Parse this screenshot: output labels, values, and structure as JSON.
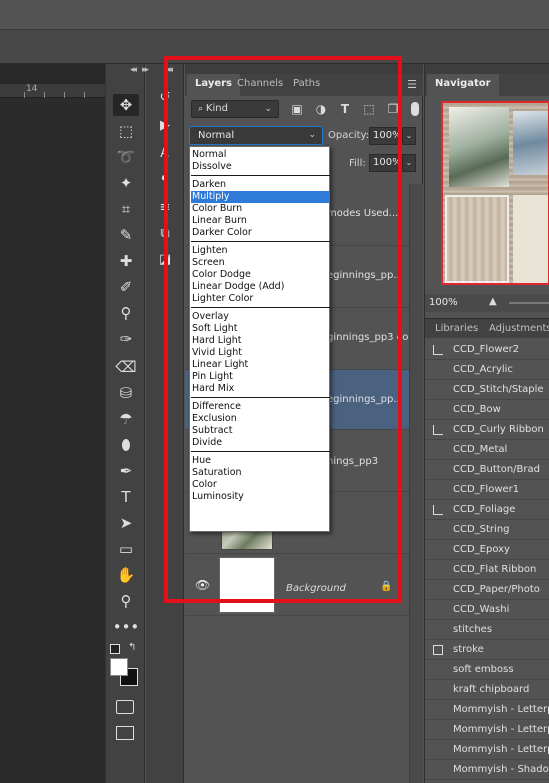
{
  "ruler": {
    "number": "14"
  },
  "tools": [
    {
      "name": "move-tool",
      "glyph": "✥"
    },
    {
      "name": "marquee-tool",
      "glyph": "⬚"
    },
    {
      "name": "lasso-tool",
      "glyph": "➰"
    },
    {
      "name": "magic-wand-tool",
      "glyph": "✦"
    },
    {
      "name": "crop-tool",
      "glyph": "⌗"
    },
    {
      "name": "eyedropper-tool",
      "glyph": "✎"
    },
    {
      "name": "healing-tool",
      "glyph": "✚"
    },
    {
      "name": "brush-tool",
      "glyph": "✐"
    },
    {
      "name": "stamp-tool",
      "glyph": "⚲"
    },
    {
      "name": "history-brush-tool",
      "glyph": "✑"
    },
    {
      "name": "eraser-tool",
      "glyph": "⌫"
    },
    {
      "name": "paint-bucket-tool",
      "glyph": "⛁"
    },
    {
      "name": "blur-tool",
      "glyph": "☂"
    },
    {
      "name": "dodge-tool",
      "glyph": "⬮"
    },
    {
      "name": "pen-tool",
      "glyph": "✒"
    },
    {
      "name": "type-tool",
      "glyph": "T"
    },
    {
      "name": "path-selection-tool",
      "glyph": "➤"
    },
    {
      "name": "shape-tool",
      "glyph": "▭"
    },
    {
      "name": "hand-tool",
      "glyph": "✋"
    },
    {
      "name": "zoom-tool",
      "glyph": "⚲"
    },
    {
      "name": "more-tools",
      "glyph": "•••"
    }
  ],
  "layers_panel": {
    "tabs": [
      "Layers",
      "Channels",
      "Paths"
    ],
    "kind_label": "Kind",
    "blend_mode": "Normal",
    "opacity_label": "Opacity:",
    "opacity_value": "100%",
    "fill_label": "Fill:",
    "fill_value": "100%",
    "layers": [
      {
        "name": "modes Used..."
      },
      {
        "name": "eginnings_pp..."
      },
      {
        "name": "ginnings_pp3 co..."
      },
      {
        "name": "eginnings_pp..."
      },
      {
        "name": "nings_pp3"
      },
      {
        "name": ""
      },
      {
        "name": "Background"
      }
    ]
  },
  "blend_modes": [
    [
      "Normal",
      "Dissolve"
    ],
    [
      "Darken",
      "Multiply",
      "Color Burn",
      "Linear Burn",
      "Darker Color"
    ],
    [
      "Lighten",
      "Screen",
      "Color Dodge",
      "Linear Dodge (Add)",
      "Lighter Color"
    ],
    [
      "Overlay",
      "Soft Light",
      "Hard Light",
      "Vivid Light",
      "Linear Light",
      "Pin Light",
      "Hard Mix"
    ],
    [
      "Difference",
      "Exclusion",
      "Subtract",
      "Divide"
    ],
    [
      "Hue",
      "Saturation",
      "Color",
      "Luminosity"
    ]
  ],
  "highlighted_blend_mode": "Multiply",
  "navigator": {
    "tab": "Navigator",
    "zoom": "100%"
  },
  "side_tabs": [
    "Libraries",
    "Adjustments"
  ],
  "actions": [
    {
      "label": "CCD_Flower2",
      "check": "mark"
    },
    {
      "label": "CCD_Acrylic",
      "check": "none"
    },
    {
      "label": "CCD_Stitch/Staple",
      "check": "none"
    },
    {
      "label": "CCD_Bow",
      "check": "none"
    },
    {
      "label": "CCD_Curly Ribbon",
      "check": "mark"
    },
    {
      "label": "CCD_Metal",
      "check": "none"
    },
    {
      "label": "CCD_Button/Brad",
      "check": "none"
    },
    {
      "label": "CCD_Flower1",
      "check": "none"
    },
    {
      "label": "CCD_Foliage",
      "check": "mark"
    },
    {
      "label": "CCD_String",
      "check": "none"
    },
    {
      "label": "CCD_Epoxy",
      "check": "none"
    },
    {
      "label": "CCD_Flat Ribbon",
      "check": "none"
    },
    {
      "label": "CCD_Paper/Photo",
      "check": "none"
    },
    {
      "label": "CCD_Washi",
      "check": "none"
    },
    {
      "label": "stitches",
      "check": "none"
    },
    {
      "label": "stroke",
      "check": "box"
    },
    {
      "label": "soft emboss",
      "check": "none"
    },
    {
      "label": "kraft chipboard",
      "check": "none"
    },
    {
      "label": "Mommyish - Letterpre",
      "check": "none"
    },
    {
      "label": "Mommyish - Letterpre",
      "check": "none"
    },
    {
      "label": "Mommyish - Letterpre",
      "check": "none"
    },
    {
      "label": "Mommyish - Shadow",
      "check": "none"
    }
  ],
  "colors": {
    "highlight": "#2d7ad8",
    "selected_layer": "#4b6180",
    "annotation_frame": "#e3101b"
  }
}
